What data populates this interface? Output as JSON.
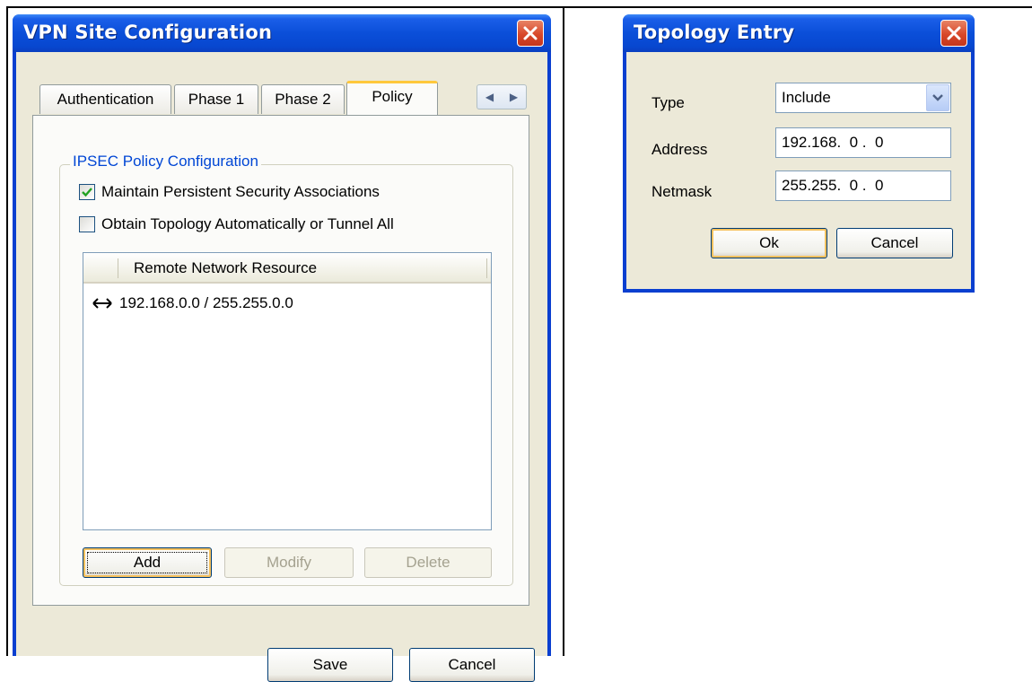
{
  "vpn_dialog": {
    "title": "VPN Site Configuration",
    "tabs": [
      {
        "label": "Authentication",
        "active": false
      },
      {
        "label": "Phase 1",
        "active": false
      },
      {
        "label": "Phase 2",
        "active": false
      },
      {
        "label": "Policy",
        "active": true
      }
    ],
    "group_label": "IPSEC Policy Configuration",
    "checkboxes": [
      {
        "label": "Maintain Persistent Security Associations",
        "checked": true
      },
      {
        "label": "Obtain Topology Automatically or Tunnel All",
        "checked": false
      }
    ],
    "list": {
      "column_header": "Remote Network Resource",
      "rows": [
        {
          "text": "192.168.0.0 / 255.255.0.0",
          "icon": "bidirectional-arrow-icon"
        }
      ]
    },
    "buttons": {
      "add": "Add",
      "modify": "Modify",
      "delete": "Delete",
      "save": "Save",
      "cancel": "Cancel"
    }
  },
  "topology_dialog": {
    "title": "Topology Entry",
    "type_label": "Type",
    "type_value": "Include",
    "address_label": "Address",
    "address_value": "192.168.  0 .  0",
    "netmask_label": "Netmask",
    "netmask_value": "255.255.  0 .  0",
    "buttons": {
      "ok": "Ok",
      "cancel": "Cancel"
    }
  },
  "colors": {
    "titlebar": "#0b4fd9",
    "dialog_face": "#ece9d8",
    "group_label": "#0046d5",
    "close_button": "#d8482a",
    "check_mark": "#21a121",
    "active_tab_accent": "#ffc83c"
  }
}
